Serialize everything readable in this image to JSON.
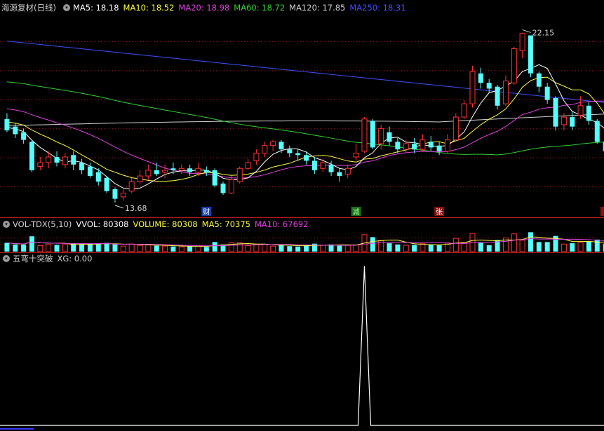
{
  "title": "海源复材(日线)",
  "ma_legend": [
    {
      "label": "MA5: 18.18",
      "color": "#ffffff"
    },
    {
      "label": "MA10: 18.52",
      "color": "#ffff3c"
    },
    {
      "label": "MA20: 18.98",
      "color": "#e040e0"
    },
    {
      "label": "MA60: 18.72",
      "color": "#30d030"
    },
    {
      "label": "MA120: 17.85",
      "color": "#d0d0d0"
    },
    {
      "label": "MA250: 18.31",
      "color": "#4050ff"
    }
  ],
  "vol_legend": [
    {
      "label": "VOL-TDX(5,10)",
      "color": "#d0d0d0"
    },
    {
      "label": "VVOL: 80308",
      "color": "#ffffff"
    },
    {
      "label": "VOLUME: 80308",
      "color": "#ffff3c"
    },
    {
      "label": "MA5: 70375",
      "color": "#ffff3c"
    },
    {
      "label": "MA10: 67692",
      "color": "#e040e0"
    }
  ],
  "ind_legend": [
    {
      "label": "五弯十突破",
      "color": "#d0d0d0"
    },
    {
      "label": "XG: 0.00",
      "color": "#d0d0d0"
    }
  ],
  "colors": {
    "up": "#ff3232",
    "down": "#54ffff",
    "grid": "#b8161a",
    "background": "#000000"
  },
  "chart_data": {
    "type": "candlestick",
    "ylim": [
      12.5,
      23.2
    ],
    "bars": 73,
    "high_label": "22.15",
    "low_label": "13.68",
    "markers": [
      "财",
      "减",
      "张"
    ],
    "candles": [
      [
        17.6,
        17.0,
        17.9,
        16.9
      ],
      [
        17.2,
        16.8,
        17.4,
        16.6
      ],
      [
        16.9,
        16.5,
        17.1,
        16.3
      ],
      [
        16.4,
        14.9,
        16.5,
        14.8
      ],
      [
        15.1,
        15.3,
        15.6,
        14.9
      ],
      [
        15.3,
        15.6,
        15.9,
        15.0
      ],
      [
        15.6,
        15.3,
        15.9,
        15.1
      ],
      [
        15.2,
        15.6,
        15.8,
        15.0
      ],
      [
        15.7,
        15.2,
        15.9,
        14.9
      ],
      [
        15.3,
        14.9,
        15.5,
        14.7
      ],
      [
        15.1,
        14.6,
        15.3,
        14.5
      ],
      [
        14.8,
        14.3,
        15.0,
        14.1
      ],
      [
        14.5,
        13.8,
        14.6,
        13.7
      ],
      [
        13.9,
        13.4,
        14.0,
        13.2
      ],
      [
        13.5,
        13.7,
        13.9,
        13.3
      ],
      [
        13.8,
        14.3,
        14.5,
        13.7
      ],
      [
        14.3,
        14.6,
        14.9,
        14.2
      ],
      [
        14.6,
        14.9,
        15.2,
        14.4
      ],
      [
        14.9,
        14.7,
        15.3,
        14.6
      ],
      [
        14.8,
        14.9,
        15.2,
        14.5
      ],
      [
        15.0,
        14.9,
        15.3,
        14.7
      ],
      [
        14.9,
        15.0,
        15.2,
        14.7
      ],
      [
        15.0,
        14.8,
        15.2,
        14.6
      ],
      [
        14.8,
        15.0,
        15.3,
        14.6
      ],
      [
        14.9,
        14.8,
        15.1,
        14.6
      ],
      [
        14.9,
        14.1,
        15.0,
        14.0
      ],
      [
        14.2,
        13.7,
        14.3,
        13.6
      ],
      [
        13.7,
        14.4,
        14.6,
        13.65
      ],
      [
        14.3,
        15.0,
        15.1,
        14.2
      ],
      [
        15.0,
        15.3,
        15.5,
        14.9
      ],
      [
        15.4,
        15.8,
        16.0,
        15.2
      ],
      [
        15.8,
        16.2,
        16.4,
        15.6
      ],
      [
        16.2,
        16.4,
        16.5,
        15.9
      ],
      [
        16.4,
        16.0,
        16.5,
        15.8
      ],
      [
        16.0,
        15.8,
        16.2,
        15.6
      ],
      [
        15.8,
        15.7,
        16.0,
        15.4
      ],
      [
        15.7,
        15.4,
        15.9,
        15.2
      ],
      [
        15.4,
        14.9,
        15.6,
        14.7
      ],
      [
        15.0,
        15.3,
        15.5,
        14.8
      ],
      [
        15.2,
        14.8,
        15.4,
        14.6
      ],
      [
        14.8,
        14.6,
        15.0,
        14.3
      ],
      [
        14.7,
        15.0,
        15.2,
        14.5
      ],
      [
        15.6,
        15.8,
        16.3,
        15.4
      ],
      [
        15.9,
        17.6,
        17.7,
        15.8
      ],
      [
        17.5,
        16.1,
        17.6,
        16.0
      ],
      [
        16.3,
        17.1,
        17.3,
        16.0
      ],
      [
        16.9,
        16.4,
        17.2,
        16.2
      ],
      [
        16.4,
        16.0,
        16.6,
        15.8
      ],
      [
        16.0,
        16.3,
        16.5,
        15.8
      ],
      [
        16.3,
        16.0,
        16.6,
        15.8
      ],
      [
        16.0,
        16.5,
        16.8,
        15.9
      ],
      [
        16.4,
        16.1,
        16.7,
        15.9
      ],
      [
        16.2,
        15.9,
        16.4,
        15.7
      ],
      [
        15.9,
        16.5,
        16.8,
        15.8
      ],
      [
        16.5,
        17.7,
        17.9,
        16.4
      ],
      [
        17.7,
        18.4,
        18.6,
        17.6
      ],
      [
        18.4,
        20.1,
        20.4,
        18.2
      ],
      [
        20.0,
        19.5,
        20.3,
        19.2
      ],
      [
        19.5,
        19.2,
        19.7,
        19.0
      ],
      [
        19.3,
        18.3,
        19.4,
        18.1
      ],
      [
        18.4,
        19.6,
        19.9,
        18.3
      ],
      [
        19.5,
        21.3,
        21.4,
        19.4
      ],
      [
        21.2,
        22.1,
        22.15,
        20.8
      ],
      [
        22.0,
        20.0,
        22.0,
        19.8
      ],
      [
        20.0,
        19.3,
        20.1,
        19.0
      ],
      [
        19.3,
        18.6,
        19.5,
        18.4
      ],
      [
        18.7,
        17.2,
        18.8,
        17.0
      ],
      [
        17.3,
        17.7,
        17.9,
        17.0
      ],
      [
        17.7,
        17.2,
        18.0,
        17.0
      ],
      [
        17.8,
        18.3,
        18.8,
        17.6
      ],
      [
        18.3,
        17.5,
        18.5,
        17.3
      ],
      [
        17.5,
        16.4,
        17.6,
        16.3
      ],
      [
        16.4,
        15.9,
        16.6,
        15.7
      ]
    ]
  }
}
